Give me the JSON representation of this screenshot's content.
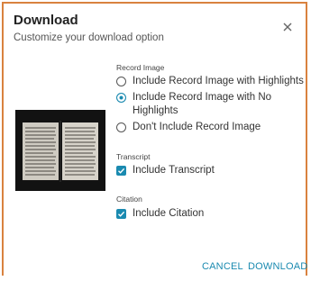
{
  "dialog": {
    "title": "Download",
    "subtitle": "Customize your download option",
    "close_icon": "close-icon"
  },
  "record_image": {
    "label": "Record Image",
    "options": [
      {
        "label": "Include Record Image with Highlights",
        "selected": false
      },
      {
        "label": "Include Record Image with No Highlights",
        "selected": true
      },
      {
        "label": "Don't Include Record Image",
        "selected": false
      }
    ]
  },
  "transcript": {
    "label": "Transcript",
    "option": {
      "label": "Include Transcript",
      "checked": true
    }
  },
  "citation": {
    "label": "Citation",
    "option": {
      "label": "Include Citation",
      "checked": true
    }
  },
  "buttons": {
    "cancel": "CANCEL",
    "download": "DOWNLOAD"
  },
  "colors": {
    "accent": "#1a8ab0",
    "border": "#d9823f"
  }
}
